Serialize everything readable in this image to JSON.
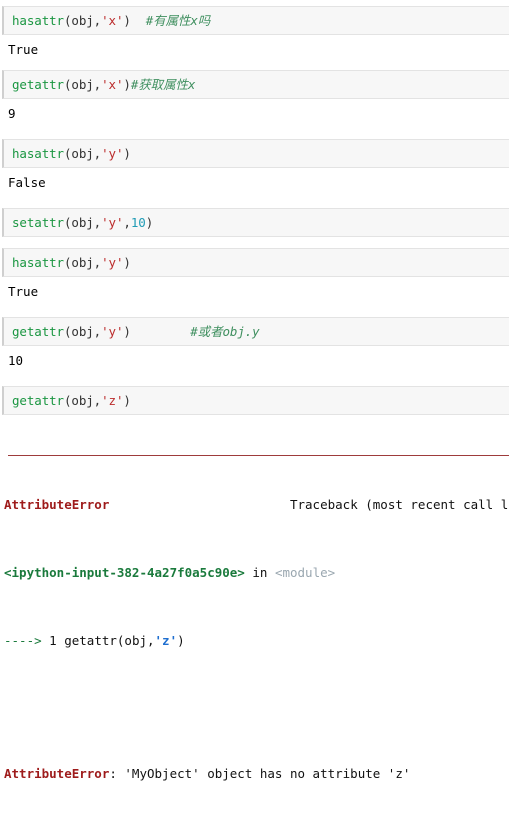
{
  "notebook": {
    "cells": [
      {
        "type": "input",
        "name": "cell-hasattr-x",
        "segments": [
          {
            "cls": "tok-fn",
            "text": "hasattr"
          },
          {
            "cls": "tok-punct",
            "text": "(obj,"
          },
          {
            "cls": "tok-str",
            "text": "'x'"
          },
          {
            "cls": "tok-punct",
            "text": ")  "
          },
          {
            "cls": "tok-comment",
            "text": "#有属性x吗"
          }
        ]
      },
      {
        "type": "output",
        "name": "output-hasattr-x",
        "text": "True"
      },
      {
        "type": "input",
        "name": "cell-getattr-x",
        "segments": [
          {
            "cls": "tok-fn",
            "text": "getattr"
          },
          {
            "cls": "tok-punct",
            "text": "(obj,"
          },
          {
            "cls": "tok-str",
            "text": "'x'"
          },
          {
            "cls": "tok-punct",
            "text": ")"
          },
          {
            "cls": "tok-comment",
            "text": "#获取属性x"
          }
        ]
      },
      {
        "type": "output",
        "name": "output-getattr-x",
        "text": "9"
      },
      {
        "type": "input",
        "name": "cell-hasattr-y-before",
        "segments": [
          {
            "cls": "tok-fn",
            "text": "hasattr"
          },
          {
            "cls": "tok-punct",
            "text": "(obj,"
          },
          {
            "cls": "tok-str",
            "text": "'y'"
          },
          {
            "cls": "tok-punct",
            "text": ")"
          }
        ]
      },
      {
        "type": "output",
        "name": "output-hasattr-y-before",
        "text": "False"
      },
      {
        "type": "input",
        "name": "cell-setattr-y",
        "segments": [
          {
            "cls": "tok-fn",
            "text": "setattr"
          },
          {
            "cls": "tok-punct",
            "text": "(obj,"
          },
          {
            "cls": "tok-str",
            "text": "'y'"
          },
          {
            "cls": "tok-punct",
            "text": ","
          },
          {
            "cls": "tok-num",
            "text": "10"
          },
          {
            "cls": "tok-punct",
            "text": ")"
          }
        ]
      },
      {
        "type": "input",
        "name": "cell-hasattr-y-after",
        "segments": [
          {
            "cls": "tok-fn",
            "text": "hasattr"
          },
          {
            "cls": "tok-punct",
            "text": "(obj,"
          },
          {
            "cls": "tok-str",
            "text": "'y'"
          },
          {
            "cls": "tok-punct",
            "text": ")"
          }
        ]
      },
      {
        "type": "output",
        "name": "output-hasattr-y-after",
        "text": "True"
      },
      {
        "type": "input",
        "name": "cell-getattr-y",
        "segments": [
          {
            "cls": "tok-fn",
            "text": "getattr"
          },
          {
            "cls": "tok-punct",
            "text": "(obj,"
          },
          {
            "cls": "tok-str",
            "text": "'y'"
          },
          {
            "cls": "tok-punct",
            "text": ")        "
          },
          {
            "cls": "tok-comment",
            "text": "#或者obj.y"
          }
        ]
      },
      {
        "type": "output",
        "name": "output-getattr-y",
        "text": "10"
      },
      {
        "type": "input",
        "name": "cell-getattr-z",
        "segments": [
          {
            "cls": "tok-fn",
            "text": "getattr"
          },
          {
            "cls": "tok-punct",
            "text": "(obj,"
          },
          {
            "cls": "tok-str",
            "text": "'z'"
          },
          {
            "cls": "tok-punct",
            "text": ")"
          }
        ]
      }
    ]
  },
  "traceback": {
    "error_name": "AttributeError",
    "header_right": "Traceback (most recent call l",
    "file_ref": "<ipython-input-382-4a27f0a5c90e>",
    "in_word": " in ",
    "scope": "<module>",
    "arrow": "----> ",
    "line_number": "1 ",
    "code_prefix": "getattr(obj,",
    "code_string": "'z'",
    "code_suffix": ")",
    "final_error_name": "AttributeError",
    "final_error_message": ": 'MyObject' object has no attribute 'z'"
  },
  "colors": {
    "cell_bg": "#f7f7f7",
    "cell_border": "#e3e3e3",
    "function_green": "#1a9641",
    "string_red": "#bb2b2b",
    "number_teal": "#1f9bb5",
    "comment_green": "#3f8f5f",
    "error_red": "#9e1b1b",
    "traceback_rule": "#9e3b3b"
  }
}
